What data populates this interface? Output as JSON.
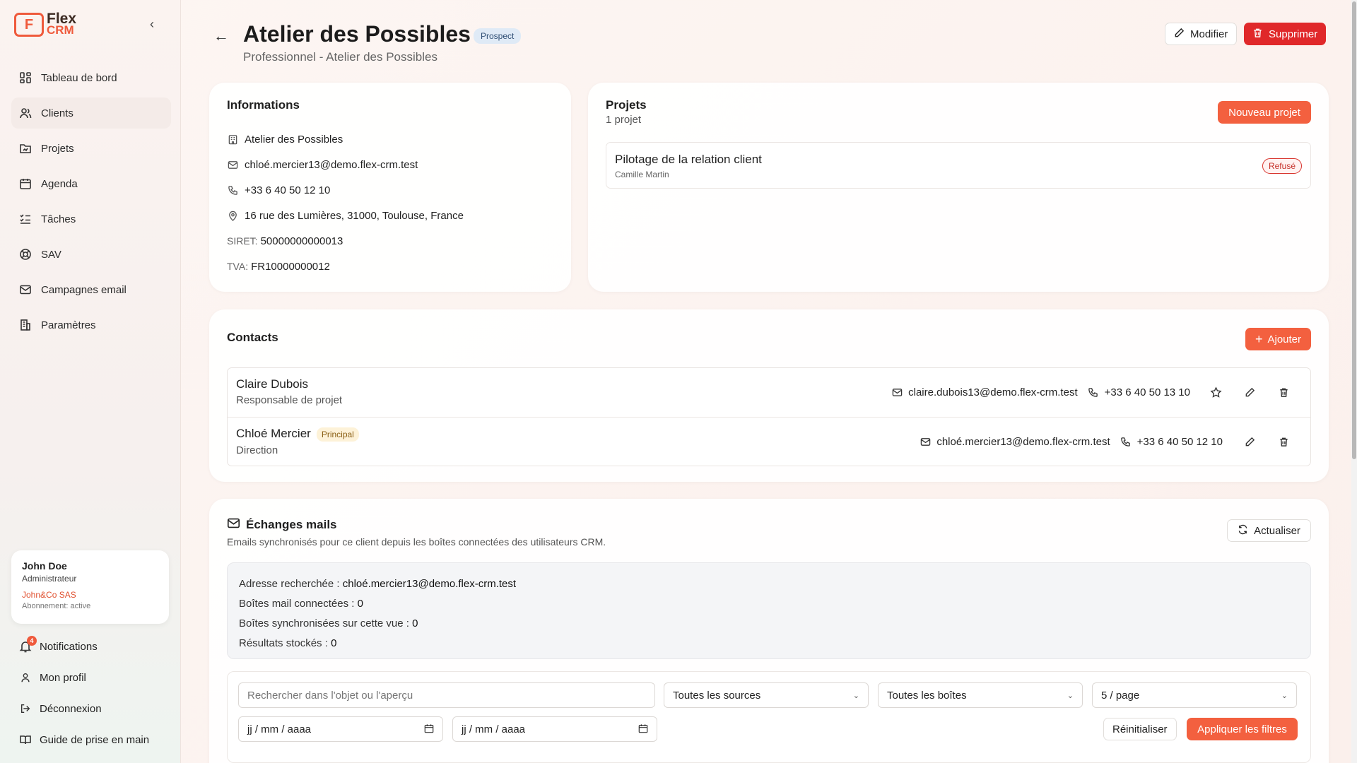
{
  "app": {
    "logo_mark": "F",
    "logo_line1": "Flex",
    "logo_line2": "CRM"
  },
  "sidebar": {
    "items": [
      {
        "label": "Tableau de bord",
        "icon": "dashboard-icon"
      },
      {
        "label": "Clients",
        "icon": "users-icon"
      },
      {
        "label": "Projets",
        "icon": "folder-icon"
      },
      {
        "label": "Agenda",
        "icon": "calendar-icon"
      },
      {
        "label": "Tâches",
        "icon": "list-checks-icon"
      },
      {
        "label": "SAV",
        "icon": "lifebuoy-icon"
      },
      {
        "label": "Campagnes email",
        "icon": "mail-icon"
      },
      {
        "label": "Paramètres",
        "icon": "building-icon"
      }
    ],
    "active": "Clients",
    "user": {
      "name": "John Doe",
      "role": "Administrateur",
      "company": "John&Co SAS",
      "subscription": "Abonnement: active"
    },
    "bottom": {
      "notifications": "Notifications",
      "notif_count": "4",
      "profile": "Mon profil",
      "logout": "Déconnexion",
      "guide": "Guide de prise en main"
    }
  },
  "header": {
    "title": "Atelier des Possibles",
    "status": "Prospect",
    "subtitle": "Professionnel - Atelier des Possibles",
    "edit_label": "Modifier",
    "delete_label": "Supprimer"
  },
  "info": {
    "heading": "Informations",
    "company": "Atelier des Possibles",
    "email": "chloé.mercier13@demo.flex-crm.test",
    "phone": "+33 6 40 50 12 10",
    "address": "16 rue des Lumières, 31000, Toulouse, France",
    "siret_label": "SIRET:",
    "siret": "50000000000013",
    "tva_label": "TVA:",
    "tva": "FR10000000012"
  },
  "projects": {
    "heading": "Projets",
    "count": "1 projet",
    "new_label": "Nouveau projet",
    "items": [
      {
        "name": "Pilotage de la relation client",
        "owner": "Camille Martin",
        "status": "Refusé"
      }
    ]
  },
  "contacts": {
    "heading": "Contacts",
    "add_label": "Ajouter",
    "items": [
      {
        "name": "Claire Dubois",
        "role": "Responsable de projet",
        "email": "claire.dubois13@demo.flex-crm.test",
        "phone": "+33 6 40 50 13 10",
        "badge": ""
      },
      {
        "name": "Chloé Mercier",
        "role": "Direction",
        "email": "chloé.mercier13@demo.flex-crm.test",
        "phone": "+33 6 40 50 12 10",
        "badge": "Principal"
      }
    ]
  },
  "mails": {
    "heading": "Échanges mails",
    "description": "Emails synchronisés pour ce client depuis les boîtes connectées des utilisateurs CRM.",
    "refresh_label": "Actualiser",
    "stats": {
      "address_label": "Adresse recherchée : ",
      "address": "chloé.mercier13@demo.flex-crm.test",
      "boxes_label": "Boîtes mail connectées : ",
      "boxes": "0",
      "synced_label": "Boîtes synchronisées sur cette vue : ",
      "synced": "0",
      "results_label": "Résultats stockés : ",
      "results": "0"
    },
    "filters": {
      "search_placeholder": "Rechercher dans l'objet ou l'aperçu",
      "source": "Toutes les sources",
      "box": "Toutes les boîtes",
      "per_page": "5 / page",
      "date_from": "jj / mm / aaaa",
      "date_to": "jj / mm / aaaa",
      "reset_label": "Réinitialiser",
      "apply_label": "Appliquer les filtres"
    }
  },
  "colors": {
    "accent": "#f3603f",
    "danger": "#e0282a"
  }
}
